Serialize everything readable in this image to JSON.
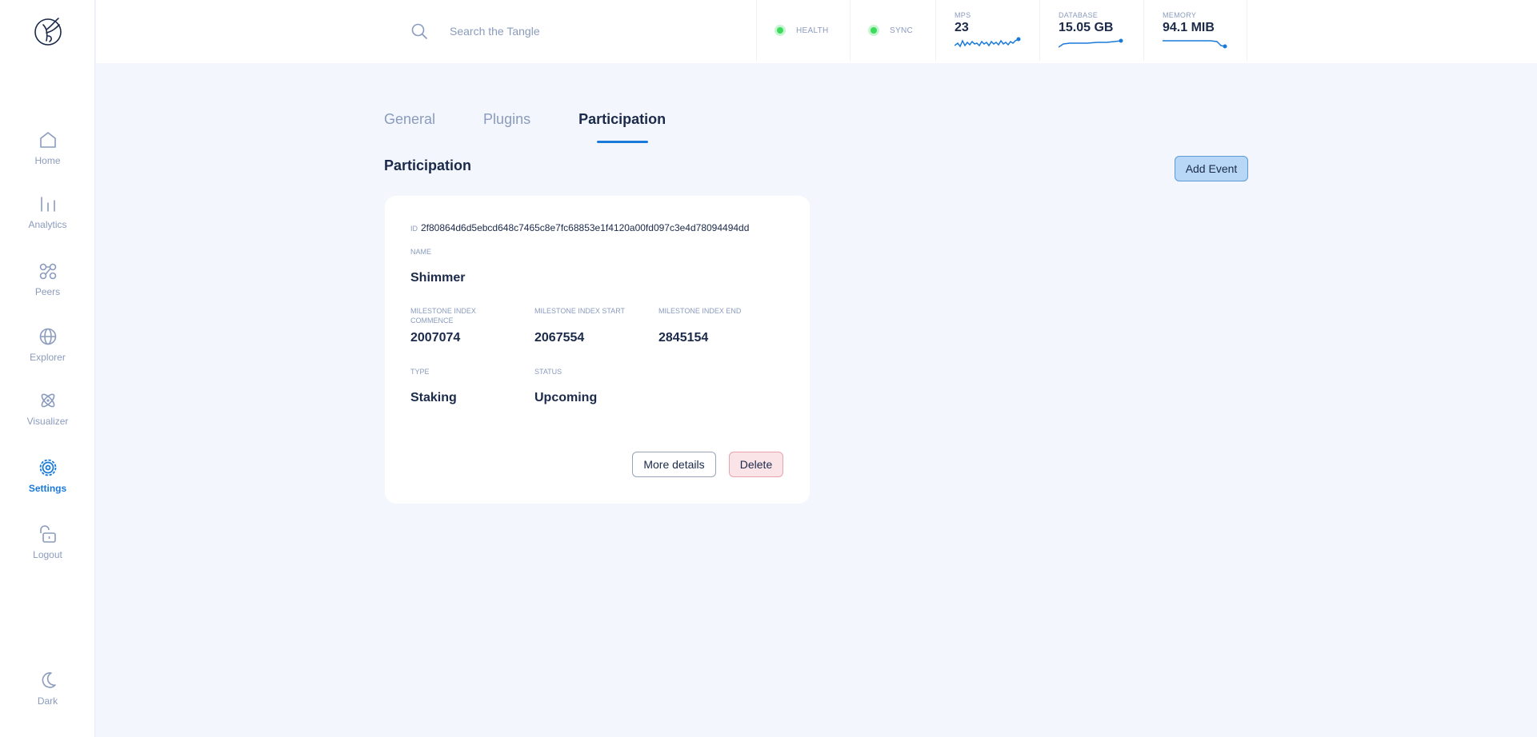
{
  "sidebar": {
    "items": [
      {
        "label": "Home",
        "icon": "home-icon"
      },
      {
        "label": "Analytics",
        "icon": "analytics-icon"
      },
      {
        "label": "Peers",
        "icon": "peers-icon"
      },
      {
        "label": "Explorer",
        "icon": "globe-icon"
      },
      {
        "label": "Visualizer",
        "icon": "atom-icon"
      },
      {
        "label": "Settings",
        "icon": "gear-icon",
        "active": true
      },
      {
        "label": "Logout",
        "icon": "lock-icon"
      }
    ],
    "theme_toggle": {
      "label": "Dark",
      "icon": "moon-icon"
    }
  },
  "header": {
    "search": {
      "placeholder": "Search the Tangle"
    },
    "health": {
      "label": "HEALTH",
      "status_color": "#3bdc5b"
    },
    "sync": {
      "label": "SYNC",
      "status_color": "#3bdc5b"
    },
    "mps": {
      "label": "MPS",
      "value": "23"
    },
    "database": {
      "label": "DATABASE",
      "value": "15.05 GB"
    },
    "memory": {
      "label": "MEMORY",
      "value": "94.1 MIB"
    }
  },
  "tabs": [
    {
      "label": "General"
    },
    {
      "label": "Plugins"
    },
    {
      "label": "Participation",
      "active": true
    }
  ],
  "main": {
    "title": "Participation",
    "add_event_label": "Add Event"
  },
  "event": {
    "id_label": "ID",
    "id": "2f80864d6d5ebcd648c7465c8e7fc68853e1f4120a00fd097c3e4d78094494dd",
    "name_label": "NAME",
    "name": "Shimmer",
    "commence_label": "MILESTONE INDEX COMMENCE",
    "commence": "2007074",
    "start_label": "MILESTONE INDEX START",
    "start": "2067554",
    "end_label": "MILESTONE INDEX END",
    "end": "2845154",
    "type_label": "TYPE",
    "type": "Staking",
    "status_label": "STATUS",
    "status": "Upcoming",
    "more_details_label": "More details",
    "delete_label": "Delete"
  },
  "colors": {
    "accent": "#1a7ad9",
    "background": "#f3f7fd",
    "text": "#1b2a4a",
    "muted": "#8a9bbd"
  }
}
